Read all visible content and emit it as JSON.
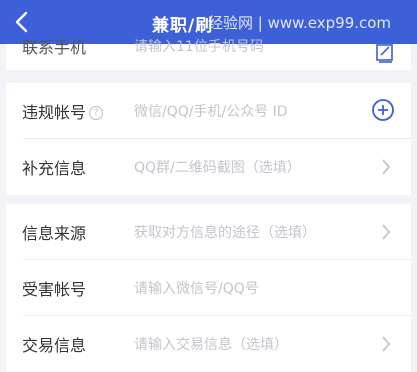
{
  "header": {
    "title": "兼职/刷",
    "watermark": "经验网 | www.exp99.com"
  },
  "form": {
    "contact": {
      "label": "联系手机",
      "placeholder": "请输入11位手机号码"
    },
    "violation_account": {
      "label": "违规帐号",
      "placeholder": "微信/QQ/手机/公众号 ID"
    },
    "supplement": {
      "label": "补充信息",
      "placeholder": "QQ群/二维码截图（选填）"
    },
    "info_source": {
      "label": "信息来源",
      "placeholder": "获取对方信息的途径（选填）"
    },
    "victim_account": {
      "label": "受害帐号",
      "placeholder": "请输入微信号/QQ号"
    },
    "transaction": {
      "label": "交易信息",
      "placeholder": "请输入交易信息（选填）"
    }
  },
  "colors": {
    "header_bg": "#3d5fd8",
    "accent": "#3d5fd8"
  },
  "icons": [
    "back-arrow-icon",
    "edit-icon",
    "plus-circle-icon",
    "help-icon",
    "chevron-right-icon"
  ]
}
